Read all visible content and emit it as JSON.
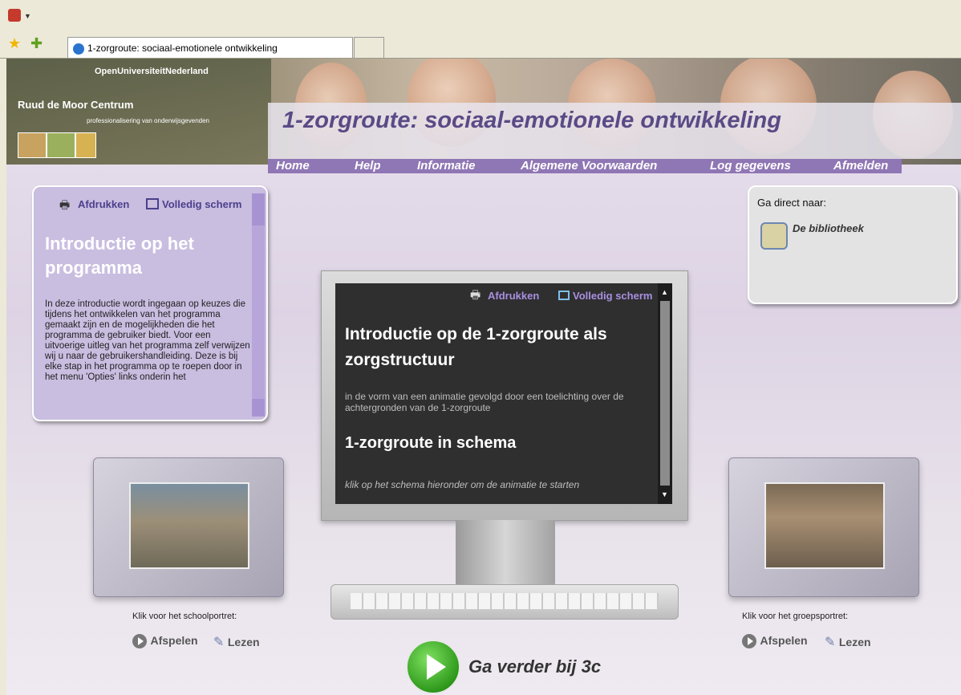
{
  "browser": {
    "tab_title": "1-zorgroute: sociaal-emotionele ontwikkeling"
  },
  "header": {
    "org_top": "OpenUniversiteitNederland",
    "org_name": "Ruud de Moor Centrum",
    "org_sub": "professionalisering van onderwijsgevenden",
    "title": "1-zorgroute: sociaal-emotionele ontwikkeling"
  },
  "nav": [
    "Home",
    "Help",
    "Informatie",
    "Algemene Voorwaarden",
    "Log gegevens",
    "Afmelden"
  ],
  "left_panel": {
    "print": "Afdrukken",
    "fullscreen": "Volledig scherm",
    "heading": "Introductie op het programma",
    "body": "In deze introductie wordt ingegaan op keuzes die tijdens het ontwikkelen van het programma gemaakt zijn en de mogelijkheden die het programma de gebruiker biedt. Voor een uitvoerige uitleg van het programma zelf verwijzen wij u naar de gebruikershandleiding. Deze is bij elke stap in het programma op te roepen door in het menu 'Opties' links onderin het"
  },
  "right_panel": {
    "label": "Ga direct naar:",
    "link": "De bibliotheek"
  },
  "monitor": {
    "print": "Afdrukken",
    "fullscreen": "Volledig scherm",
    "heading": "Introductie op de 1-zorgroute als zorgstructuur",
    "sub": "in de vorm van een animatie gevolgd door een toelichting over de achtergronden van de 1-zorgroute",
    "heading2": "1-zorgroute in schema",
    "hint": "klik op het schema hieronder om de animatie te starten"
  },
  "school_portrait": {
    "caption": "Klik voor het schoolportret:",
    "play": "Afspelen",
    "read": "Lezen"
  },
  "group_portrait": {
    "caption": "Klik voor het groepsportret:",
    "play": "Afspelen",
    "read": "Lezen"
  },
  "continue": {
    "label": "Ga verder bij 3c"
  },
  "colors": {
    "accent": "#8f76b4",
    "title": "#5a4a86"
  }
}
